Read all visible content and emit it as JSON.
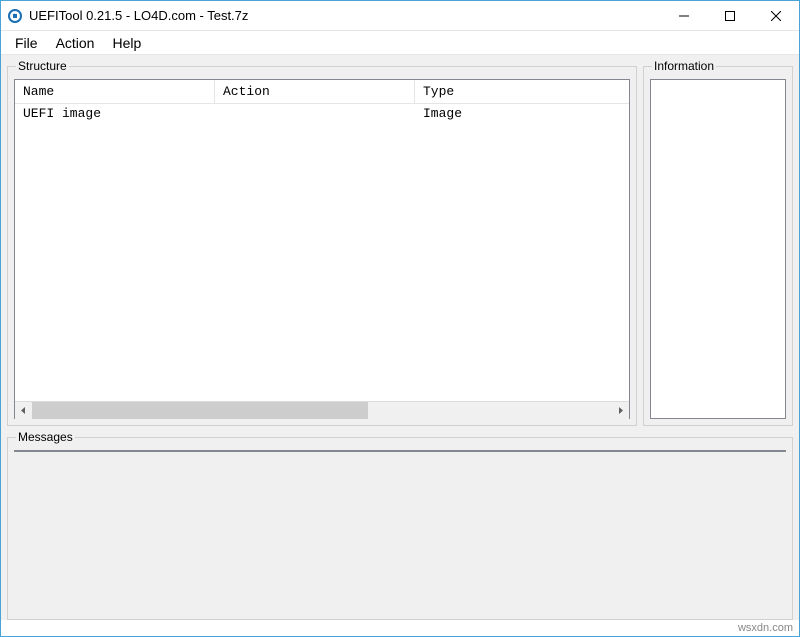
{
  "window": {
    "title": "UEFITool 0.21.5 - LO4D.com - Test.7z"
  },
  "menu": {
    "file": "File",
    "action": "Action",
    "help": "Help"
  },
  "panels": {
    "structure": {
      "title": "Structure",
      "columns": {
        "name": "Name",
        "action": "Action",
        "type": "Type"
      },
      "rows": [
        {
          "name": "UEFI image",
          "action": "",
          "type": "Image"
        }
      ]
    },
    "information": {
      "title": "Information"
    },
    "messages": {
      "title": "Messages"
    }
  },
  "footer": {
    "watermark": "wsxdn.com"
  }
}
